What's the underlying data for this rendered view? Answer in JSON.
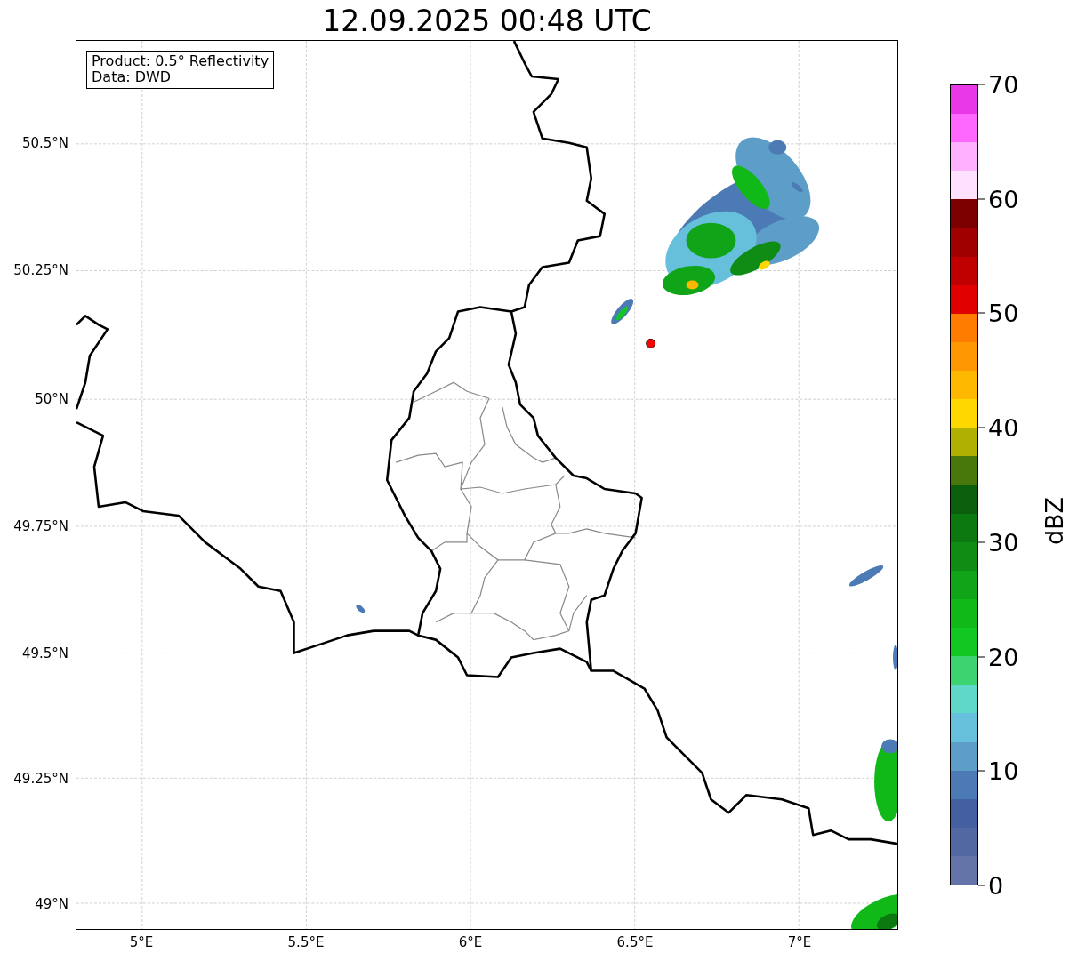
{
  "title": "12.09.2025 00:48 UTC",
  "info_box": {
    "lines": [
      "Product: 0.5° Reflectivity",
      "Data: DWD"
    ]
  },
  "map": {
    "y_ticks": [
      "50.5°N",
      "50.25°N",
      "50°N",
      "49.75°N",
      "49.5°N",
      "49.25°N",
      "49°N"
    ],
    "x_ticks": [
      "5°E",
      "5.5°E",
      "6°E",
      "6.5°E",
      "7°E"
    ]
  },
  "colorbar": {
    "label": "dBZ",
    "ticks": [
      "70",
      "60",
      "50",
      "40",
      "30",
      "20",
      "10",
      "0"
    ],
    "segments": [
      {
        "color": "#e838e8"
      },
      {
        "color": "#ff68ff"
      },
      {
        "color": "#ffb0ff"
      },
      {
        "color": "#ffe0ff"
      },
      {
        "color": "#7c0000"
      },
      {
        "color": "#a00000"
      },
      {
        "color": "#c00000"
      },
      {
        "color": "#e00000"
      },
      {
        "color": "#ff7c00"
      },
      {
        "color": "#ff9800"
      },
      {
        "color": "#ffb800"
      },
      {
        "color": "#ffd800"
      },
      {
        "color": "#b0b000"
      },
      {
        "color": "#48780c"
      },
      {
        "color": "#0a5e0c"
      },
      {
        "color": "#0c7810"
      },
      {
        "color": "#0e8c14"
      },
      {
        "color": "#10a418"
      },
      {
        "color": "#10b818"
      },
      {
        "color": "#10c820"
      },
      {
        "color": "#3cd470"
      },
      {
        "color": "#60d8c8"
      },
      {
        "color": "#66c0dc"
      },
      {
        "color": "#5c9ec8"
      },
      {
        "color": "#4c7ab4"
      },
      {
        "color": "#4560a0"
      },
      {
        "color": "#5268a2"
      },
      {
        "color": "#6474a8"
      }
    ]
  }
}
